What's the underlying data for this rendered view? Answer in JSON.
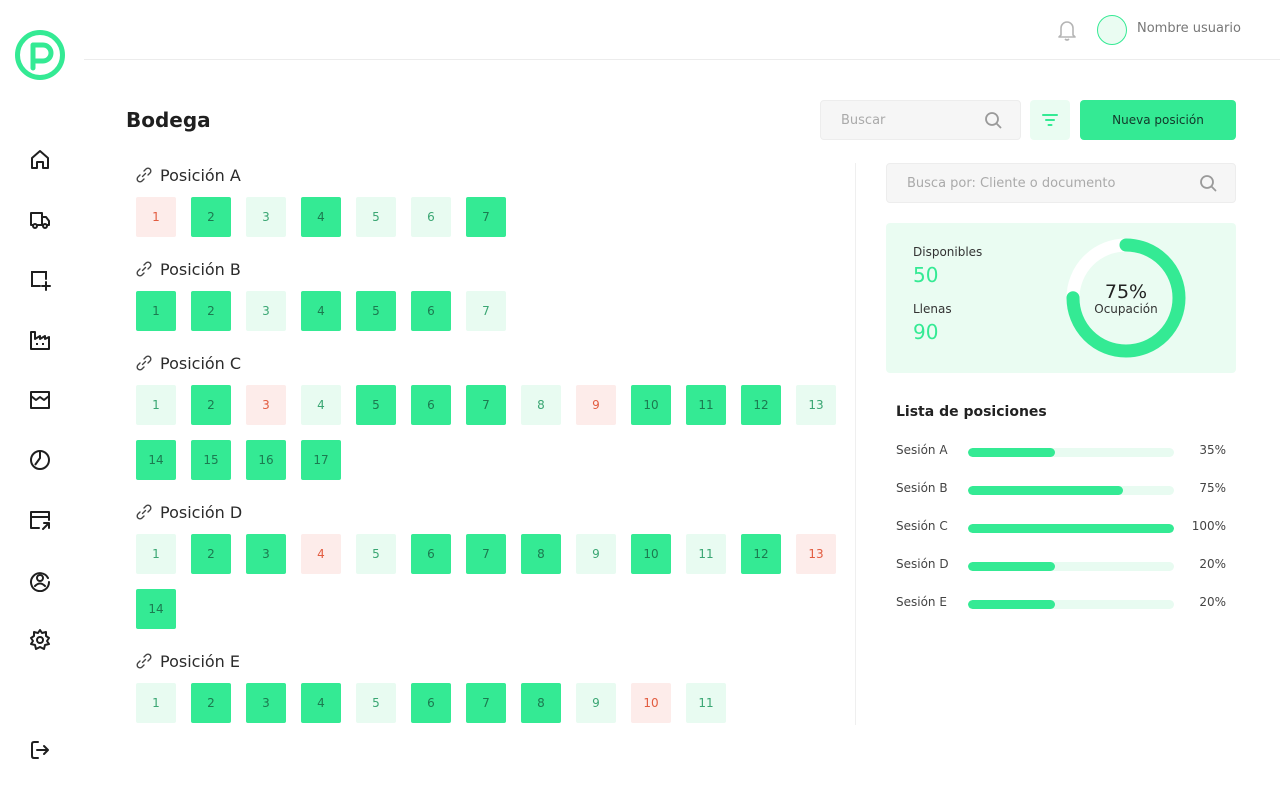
{
  "header": {
    "username": "Nombre usuario"
  },
  "toolbar": {
    "title": "Bodega",
    "search_placeholder": "Buscar",
    "new_button": "Nueva posición"
  },
  "colors": {
    "accent": "#34ea94",
    "accent_light": "#e8fbf1",
    "alert": "#e25c40",
    "alert_light": "#fdecea"
  },
  "sidebar": {
    "items": [
      {
        "name": "home-icon"
      },
      {
        "name": "truck-icon"
      },
      {
        "name": "add-screen-icon"
      },
      {
        "name": "factory-icon"
      },
      {
        "name": "inbox-icon"
      },
      {
        "name": "chart-pie-icon"
      },
      {
        "name": "export-icon"
      },
      {
        "name": "user-circle-icon"
      },
      {
        "name": "settings-icon"
      }
    ],
    "logout": "logout-icon"
  },
  "positions": [
    {
      "title": "Posición A",
      "slots": [
        {
          "n": "1",
          "s": "red"
        },
        {
          "n": "2",
          "s": "full"
        },
        {
          "n": "3",
          "s": "light"
        },
        {
          "n": "4",
          "s": "full"
        },
        {
          "n": "5",
          "s": "light"
        },
        {
          "n": "6",
          "s": "light"
        },
        {
          "n": "7",
          "s": "full"
        }
      ]
    },
    {
      "title": "Posición B",
      "slots": [
        {
          "n": "1",
          "s": "full"
        },
        {
          "n": "2",
          "s": "full"
        },
        {
          "n": "3",
          "s": "light"
        },
        {
          "n": "4",
          "s": "full"
        },
        {
          "n": "5",
          "s": "full"
        },
        {
          "n": "6",
          "s": "full"
        },
        {
          "n": "7",
          "s": "light"
        }
      ]
    },
    {
      "title": "Posición C",
      "slots": [
        {
          "n": "1",
          "s": "light"
        },
        {
          "n": "2",
          "s": "full"
        },
        {
          "n": "3",
          "s": "red"
        },
        {
          "n": "4",
          "s": "light"
        },
        {
          "n": "5",
          "s": "full"
        },
        {
          "n": "6",
          "s": "full"
        },
        {
          "n": "7",
          "s": "full"
        },
        {
          "n": "8",
          "s": "light"
        },
        {
          "n": "9",
          "s": "red"
        },
        {
          "n": "10",
          "s": "full"
        },
        {
          "n": "11",
          "s": "full"
        },
        {
          "n": "12",
          "s": "full"
        },
        {
          "n": "13",
          "s": "light"
        },
        {
          "n": "14",
          "s": "full"
        },
        {
          "n": "15",
          "s": "full"
        },
        {
          "n": "16",
          "s": "full"
        },
        {
          "n": "17",
          "s": "full"
        }
      ]
    },
    {
      "title": "Posición D",
      "slots": [
        {
          "n": "1",
          "s": "light"
        },
        {
          "n": "2",
          "s": "full"
        },
        {
          "n": "3",
          "s": "full"
        },
        {
          "n": "4",
          "s": "red"
        },
        {
          "n": "5",
          "s": "light"
        },
        {
          "n": "6",
          "s": "full"
        },
        {
          "n": "7",
          "s": "full"
        },
        {
          "n": "8",
          "s": "full"
        },
        {
          "n": "9",
          "s": "light"
        },
        {
          "n": "10",
          "s": "full"
        },
        {
          "n": "11",
          "s": "light"
        },
        {
          "n": "12",
          "s": "full"
        },
        {
          "n": "13",
          "s": "red"
        },
        {
          "n": "14",
          "s": "full"
        }
      ]
    },
    {
      "title": "Posición E",
      "slots": [
        {
          "n": "1",
          "s": "light"
        },
        {
          "n": "2",
          "s": "full"
        },
        {
          "n": "3",
          "s": "full"
        },
        {
          "n": "4",
          "s": "full"
        },
        {
          "n": "5",
          "s": "light"
        },
        {
          "n": "6",
          "s": "full"
        },
        {
          "n": "7",
          "s": "full"
        },
        {
          "n": "8",
          "s": "full"
        },
        {
          "n": "9",
          "s": "light"
        },
        {
          "n": "10",
          "s": "red"
        },
        {
          "n": "11",
          "s": "light"
        }
      ]
    }
  ],
  "panel": {
    "search_placeholder": "Busca por: Cliente o documento",
    "disponibles_label": "Disponibles",
    "disponibles_value": "50",
    "llenas_label": "Llenas",
    "llenas_value": "90",
    "occupancy_pct": "75%",
    "occupancy_value": 0.75,
    "occupancy_label": "Ocupación",
    "list_title": "Lista de posiciones",
    "list": [
      {
        "label": "Sesión A",
        "pct": "35%",
        "value": 0.42
      },
      {
        "label": "Sesión B",
        "pct": "75%",
        "value": 0.75
      },
      {
        "label": "Sesión C",
        "pct": "100%",
        "value": 1.0
      },
      {
        "label": "Sesión D",
        "pct": "20%",
        "value": 0.42
      },
      {
        "label": "Sesión E",
        "pct": "20%",
        "value": 0.42
      }
    ]
  }
}
